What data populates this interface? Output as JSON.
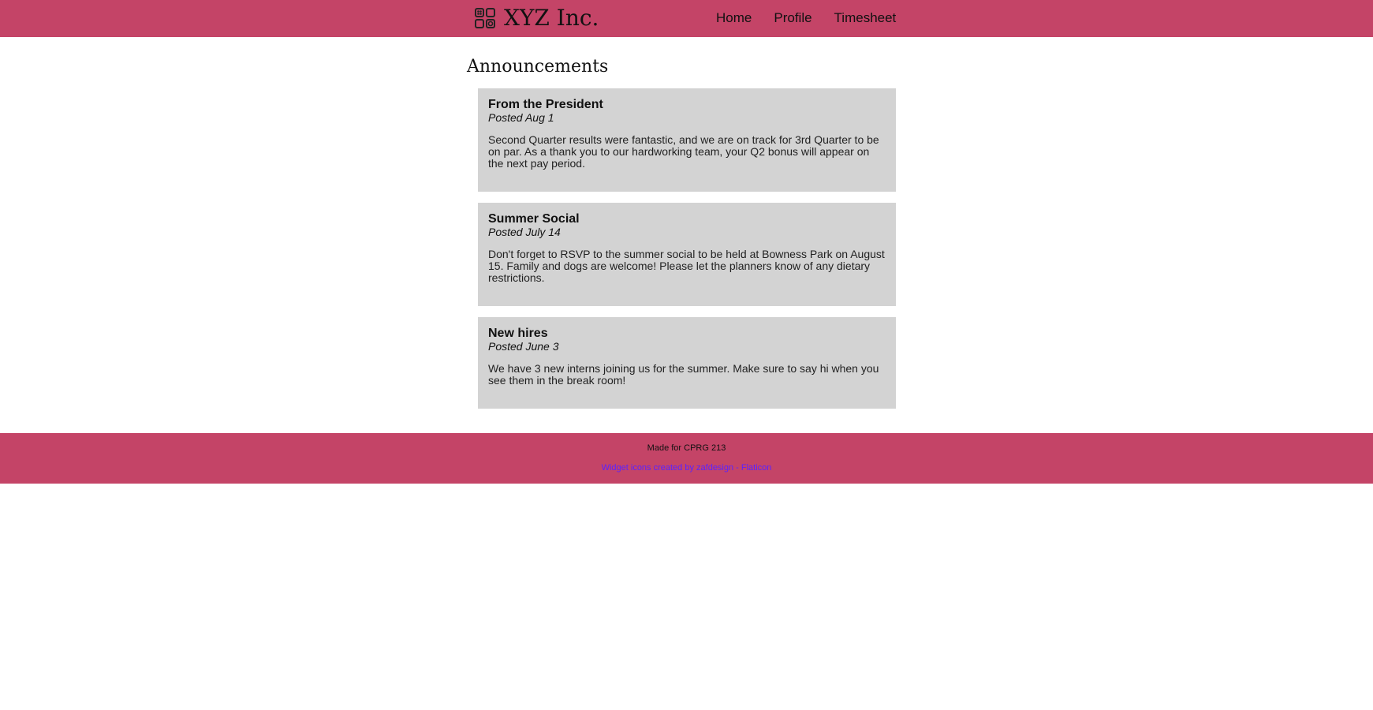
{
  "header": {
    "brand_name": "XYZ Inc.",
    "logo_icon": "widget-grid-icon",
    "nav": [
      {
        "label": "Home"
      },
      {
        "label": "Profile"
      },
      {
        "label": "Timesheet"
      }
    ]
  },
  "main": {
    "title": "Announcements",
    "announcements": [
      {
        "title": "From the President",
        "date": "Posted Aug 1",
        "body": "Second Quarter results were fantastic, and we are on track for 3rd Quarter to be on par. As a thank you to our hardworking team, your Q2 bonus will appear on the next pay period."
      },
      {
        "title": "Summer Social",
        "date": "Posted July 14",
        "body": "Don't forget to RSVP to the summer social to be held at Bowness Park on August 15. Family and dogs are welcome! Please let the planners know of any dietary restrictions."
      },
      {
        "title": "New hires",
        "date": "Posted June 3",
        "body": "We have 3 new interns joining us for the summer. Make sure to say hi when you see them in the break room!"
      }
    ]
  },
  "footer": {
    "made_for": "Made for CPRG 213",
    "credit_link": "Widget icons created by zafdesign - Flaticon"
  },
  "colors": {
    "brand": "#c44467",
    "card_bg": "#d3d3d3",
    "link": "#5a22ff"
  }
}
